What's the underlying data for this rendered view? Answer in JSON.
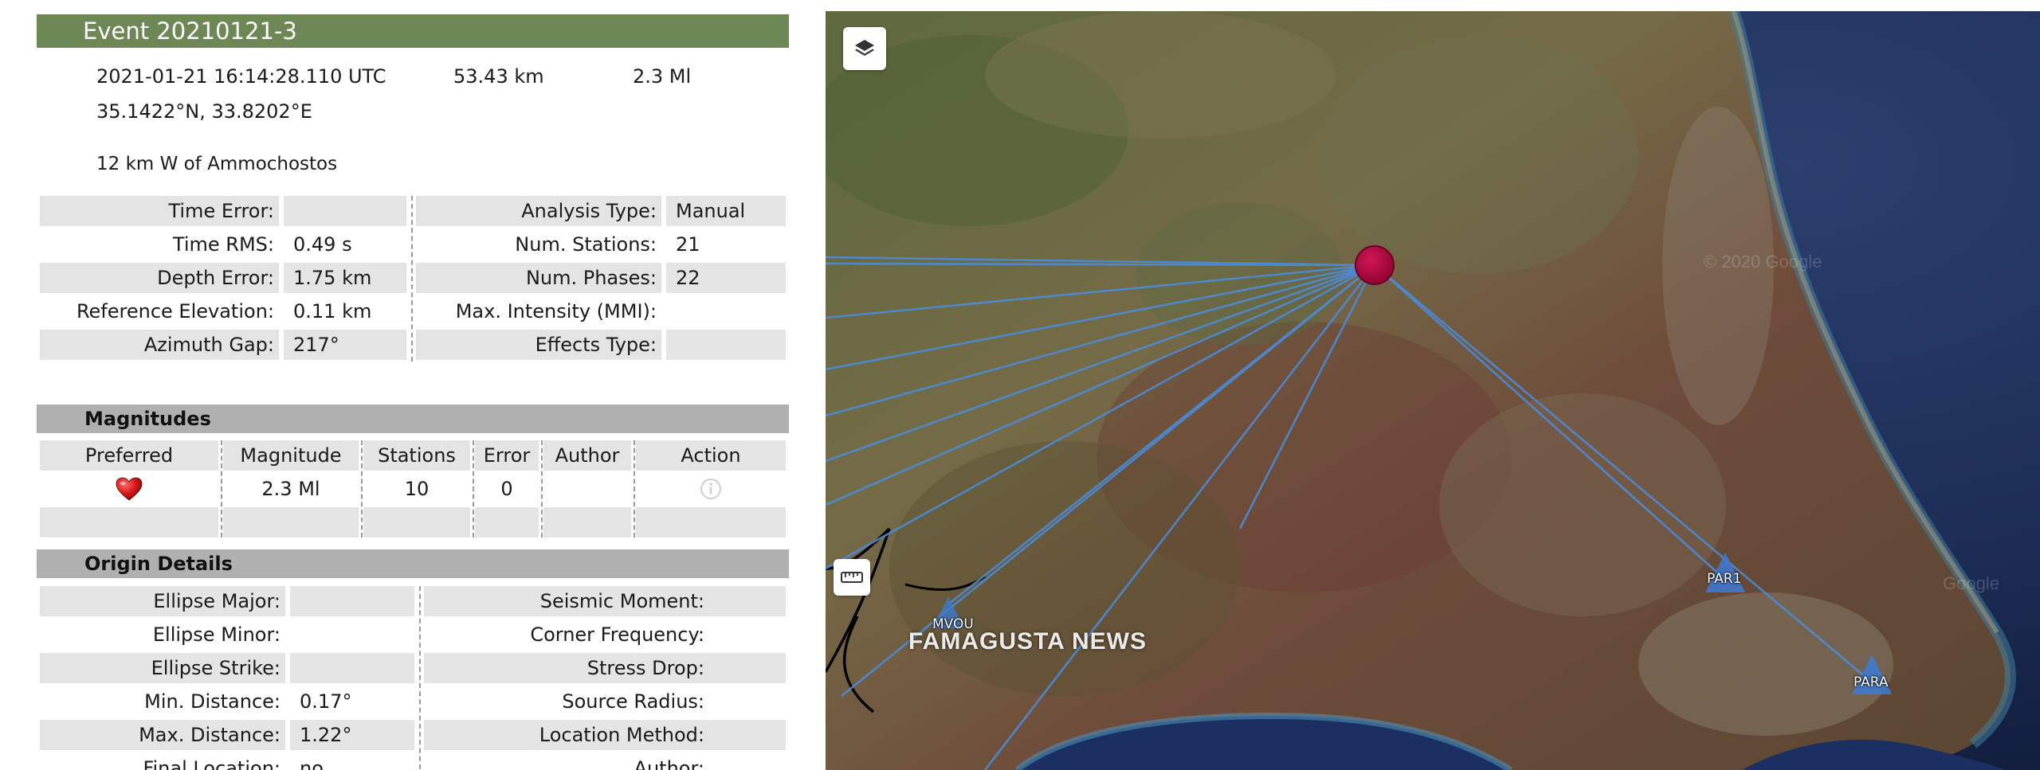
{
  "event": {
    "title": "Event 20210121-3",
    "datetime": "2021-01-21 16:14:28.110 UTC",
    "depth": "53.43 km",
    "magnitude": "2.3 Ml",
    "coords": "35.1422°N, 33.8202°E",
    "region": "12 km W of Ammochostos"
  },
  "params": {
    "time_error": {
      "label": "Time Error:",
      "value": ""
    },
    "time_rms": {
      "label": "Time RMS:",
      "value": "0.49 s"
    },
    "depth_error": {
      "label": "Depth Error:",
      "value": "1.75 km"
    },
    "ref_elev": {
      "label": "Reference Elevation:",
      "value": "0.11 km"
    },
    "az_gap": {
      "label": "Azimuth Gap:",
      "value": "217°"
    },
    "analysis_type": {
      "label": "Analysis Type:",
      "value": "Manual"
    },
    "num_stations": {
      "label": "Num. Stations:",
      "value": "21"
    },
    "num_phases": {
      "label": "Num. Phases:",
      "value": "22"
    },
    "max_intensity": {
      "label": "Max. Intensity (MMI):",
      "value": ""
    },
    "effects_type": {
      "label": "Effects Type:",
      "value": ""
    }
  },
  "magnitudes": {
    "title": "Magnitudes",
    "headers": {
      "preferred": "Preferred",
      "magnitude": "Magnitude",
      "stations": "Stations",
      "error": "Error",
      "author": "Author",
      "action": "Action"
    },
    "row": {
      "magnitude": "2.3 Ml",
      "stations": "10",
      "error": "0",
      "author": ""
    }
  },
  "origin": {
    "title": "Origin Details",
    "ellipse_major": {
      "label": "Ellipse Major:",
      "value": ""
    },
    "ellipse_minor": {
      "label": "Ellipse Minor:",
      "value": ""
    },
    "ellipse_strike": {
      "label": "Ellipse Strike:",
      "value": ""
    },
    "min_distance": {
      "label": "Min. Distance:",
      "value": "0.17°"
    },
    "max_distance": {
      "label": "Max. Distance:",
      "value": "1.22°"
    },
    "final_location": {
      "label": "Final Location:",
      "value": "no"
    },
    "seismic_moment": {
      "label": "Seismic Moment:",
      "value": ""
    },
    "corner_freq": {
      "label": "Corner Frequency:",
      "value": ""
    },
    "stress_drop": {
      "label": "Stress Drop:",
      "value": ""
    },
    "source_radius": {
      "label": "Source Radius:",
      "value": ""
    },
    "location_method": {
      "label": "Location Method:",
      "value": ""
    },
    "author": {
      "label": "Author:",
      "value": ""
    }
  },
  "map": {
    "stations": [
      "MVOU",
      "PAR1",
      "PARA"
    ],
    "watermark": "FAMAGUSTA NEWS",
    "copyright": "© 2020 Google",
    "copyright2": "Google",
    "epicenter_color": "#b0063a",
    "ray_color": "#4a8ee0",
    "station_color": "#3d7ad6"
  }
}
